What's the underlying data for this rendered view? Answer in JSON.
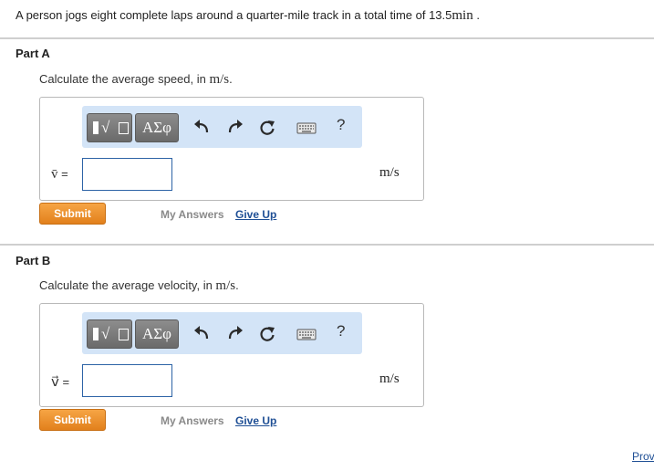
{
  "problem": {
    "text": "A person jogs eight complete laps around a quarter-mile track in a total time of 13.5",
    "unit": "min",
    "suffix": " ."
  },
  "toolbar": {
    "templates_icon": "fraction-radical-template-icon",
    "greek_label": "ΑΣφ",
    "undo_icon": "undo-icon",
    "redo_icon": "redo-icon",
    "reset_icon": "reset-icon",
    "keyboard_icon": "keyboard-icon",
    "help_label": "?"
  },
  "parts": [
    {
      "title": "Part A",
      "prompt": "Calculate the average speed, in ",
      "prompt_unit": "m/s",
      "prompt_end": ".",
      "variable": "v̄",
      "equals": "=",
      "value": "",
      "unit": "m/s",
      "submit_label": "Submit",
      "my_answers_label": "My Answers",
      "give_up_label": "Give Up"
    },
    {
      "title": "Part B",
      "prompt": "Calculate the average velocity, in ",
      "prompt_unit": "m/s",
      "prompt_end": ".",
      "variable": "v⃗",
      "equals": "=",
      "value": "",
      "unit": "m/s",
      "submit_label": "Submit",
      "my_answers_label": "My Answers",
      "give_up_label": "Give Up"
    }
  ],
  "footer": {
    "link_label": "Prov"
  },
  "colors": {
    "accent": "#e8891f",
    "toolbar_bg": "#d3e4f7",
    "link": "#1f4f95"
  }
}
